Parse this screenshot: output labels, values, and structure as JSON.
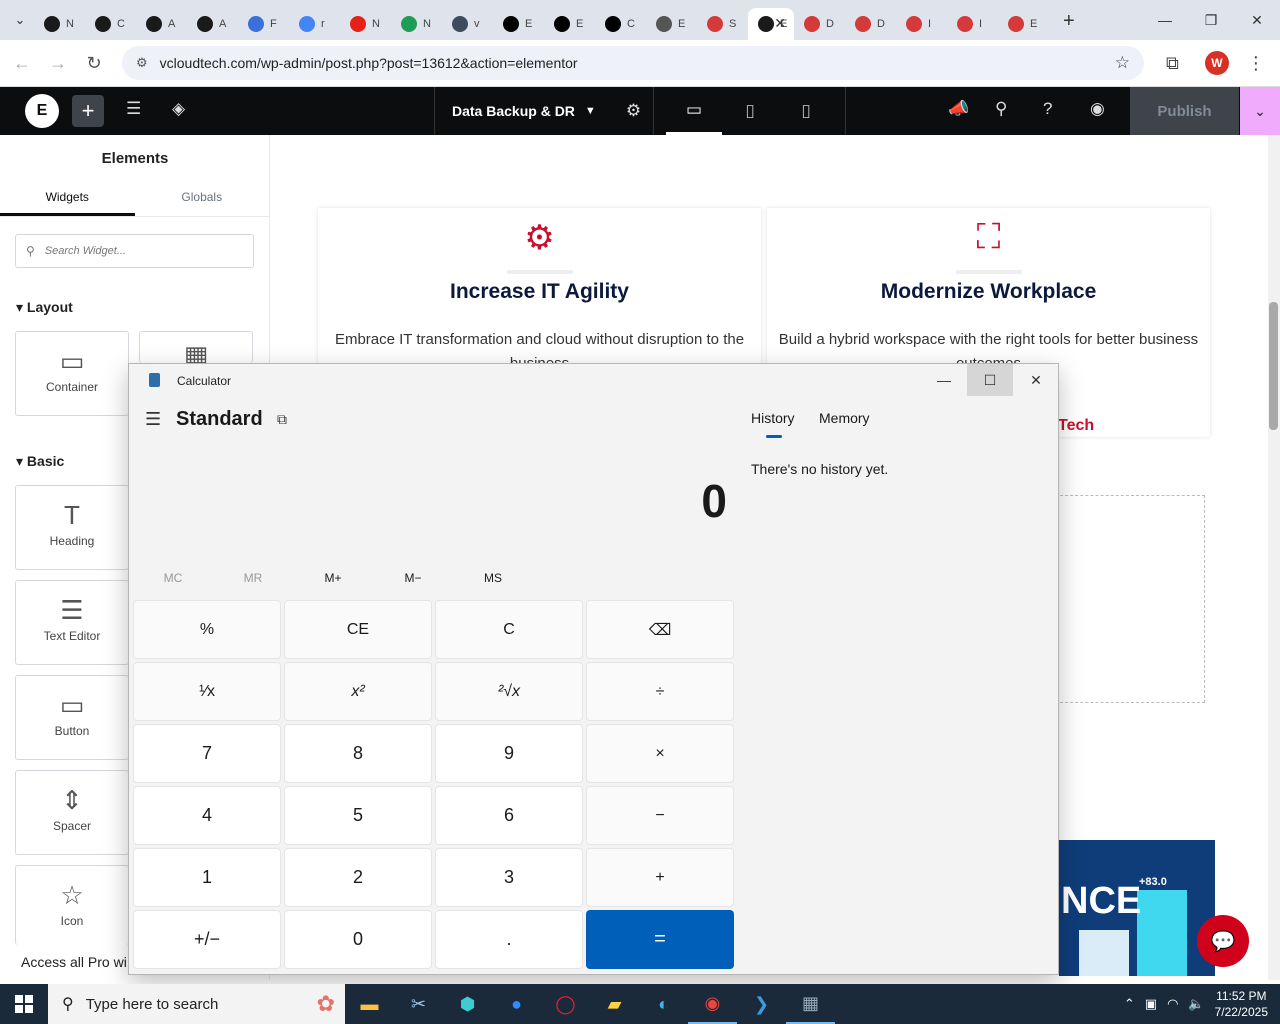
{
  "browser": {
    "tabs": [
      {
        "label": "N",
        "icon": "openai-icon",
        "color": "#1a1a1a"
      },
      {
        "label": "C",
        "icon": "openai-icon",
        "color": "#1a1a1a"
      },
      {
        "label": "A",
        "icon": "openai-icon",
        "color": "#1a1a1a"
      },
      {
        "label": "A",
        "icon": "openai-icon",
        "color": "#1a1a1a"
      },
      {
        "label": "F",
        "icon": "feather-icon",
        "color": "#3b6fd9"
      },
      {
        "label": "r",
        "icon": "google-icon",
        "color": "#4285f4"
      },
      {
        "label": "N",
        "icon": "youtube-icon",
        "color": "#e62117"
      },
      {
        "label": "N",
        "icon": "w-icon",
        "color": "#1f9d55"
      },
      {
        "label": "v",
        "icon": "linkedin-icon",
        "color": "#3d4b5c"
      },
      {
        "label": "E",
        "icon": "x-icon",
        "color": "#000000"
      },
      {
        "label": "E",
        "icon": "x-icon",
        "color": "#000000"
      },
      {
        "label": "C",
        "icon": "asterisk-icon",
        "color": "#000000"
      },
      {
        "label": "E",
        "icon": "globe-icon",
        "color": "#555555"
      },
      {
        "label": "S",
        "icon": "gem-icon",
        "color": "#d43a3a"
      },
      {
        "label": "E",
        "icon": "elementor-icon",
        "color": "#1a1a1a",
        "active": true
      },
      {
        "label": "D",
        "icon": "gem-icon",
        "color": "#d43a3a"
      },
      {
        "label": "D",
        "icon": "gem-icon",
        "color": "#d43a3a"
      },
      {
        "label": "I",
        "icon": "gem-icon",
        "color": "#d43a3a"
      },
      {
        "label": "I",
        "icon": "gem-icon",
        "color": "#d43a3a"
      },
      {
        "label": "E",
        "icon": "gem-icon",
        "color": "#d43a3a"
      }
    ],
    "url": "vcloudtech.com/wp-admin/post.php?post=13612&action=elementor",
    "profile_initial": "W"
  },
  "elementor": {
    "page_title": "Data Backup & DR",
    "publish_label": "Publish",
    "panel": {
      "title": "Elements",
      "tabs": [
        "Widgets",
        "Globals"
      ],
      "search_placeholder": "Search Widget...",
      "layout_heading": "Layout",
      "basic_heading": "Basic",
      "widgets": {
        "container": "Container",
        "heading": "Heading",
        "text_editor": "Text Editor",
        "button": "Button",
        "spacer": "Spacer",
        "icon": "Icon"
      },
      "access_pro": "Access all Pro wi"
    },
    "canvas": {
      "card1": {
        "title": "Increase IT Agility",
        "text": "Embrace IT transformation and cloud without disruption to the business"
      },
      "card2": {
        "title": "Modernize Workplace",
        "text": "Build a hybrid workspace with the right tools for better business outcomes"
      },
      "tech_link": "Tech",
      "banner_text": "NCE",
      "banner_value": "+83.0",
      "brand_red": "#c8102e"
    }
  },
  "calculator": {
    "title": "Calculator",
    "mode": "Standard",
    "display": "0",
    "memory_buttons": [
      "MC",
      "MR",
      "M+",
      "M−",
      "MS"
    ],
    "keys": [
      [
        "%",
        "CE",
        "C",
        "⌫"
      ],
      [
        "¹⁄x",
        "x²",
        "²√x",
        "÷"
      ],
      [
        "7",
        "8",
        "9",
        "×"
      ],
      [
        "4",
        "5",
        "6",
        "−"
      ],
      [
        "1",
        "2",
        "3",
        "+"
      ],
      [
        "+/−",
        "0",
        ".",
        "="
      ]
    ],
    "history_tab": "History",
    "memory_tab": "Memory",
    "history_empty": "There's no history yet.",
    "accent": "#005fb8"
  },
  "taskbar": {
    "search_placeholder": "Type here to search",
    "time": "11:52 PM",
    "date": "7/22/2025"
  }
}
